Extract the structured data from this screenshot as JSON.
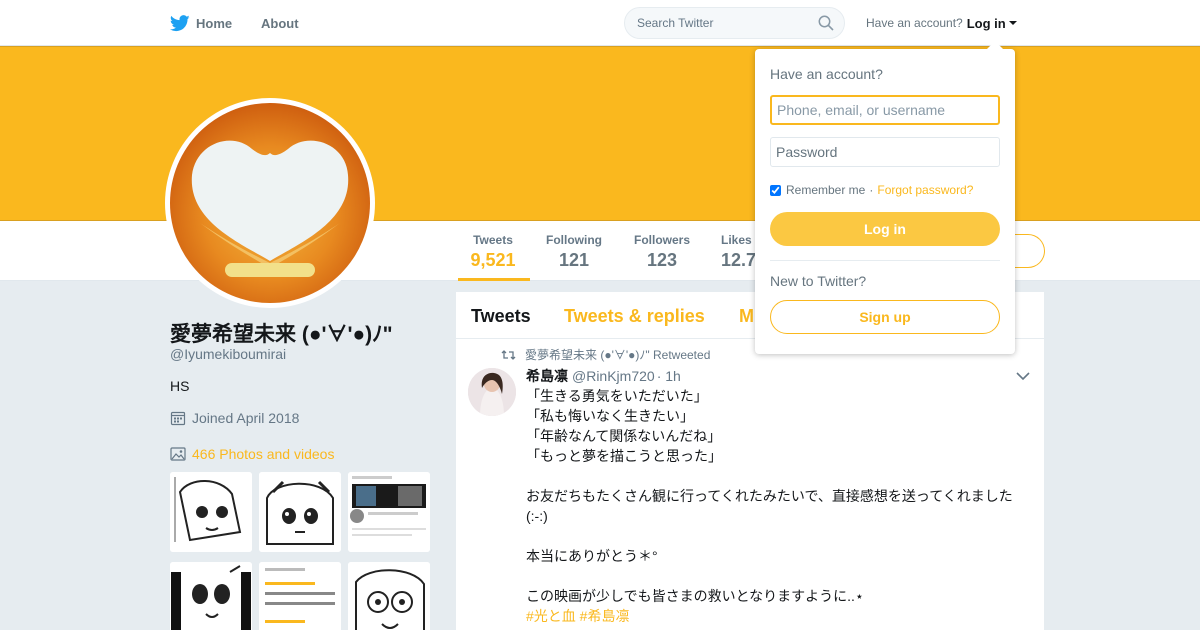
{
  "nav": {
    "home_label": "Home",
    "about_label": "About",
    "search_placeholder": "Search Twitter",
    "have_account": "Have an account?",
    "login_label": "Log in"
  },
  "colors": {
    "accent": "#fab81e",
    "banner": "#fab81e",
    "twitter_blue": "#1da1f2"
  },
  "profile": {
    "name": "愛夢希望未来 (●'∀'●)ﾉ\"",
    "handle": "@Iyumekiboumirai",
    "bio": "HS",
    "joined": "Joined April 2018",
    "photos_link": "466 Photos and videos"
  },
  "stats": [
    {
      "label": "Tweets",
      "value": "9,521"
    },
    {
      "label": "Following",
      "value": "121"
    },
    {
      "label": "Followers",
      "value": "123"
    },
    {
      "label": "Likes",
      "value": "12.7"
    }
  ],
  "timeline": {
    "tabs": [
      "Tweets",
      "Tweets & replies",
      "M"
    ],
    "retweet_context": "愛夢希望未来 (●'∀'●)ﾉ\" Retweeted",
    "tweet": {
      "name": "希島凛",
      "handle": "@RinKjm720",
      "time": "· 1h",
      "lines": [
        "「生きる勇気をいただいた」",
        "「私も悔いなく生きたい」",
        "「年齢なんて関係ないんだね」",
        "「もっと夢を描こうと思った」",
        "",
        "お友だちもたくさん観に行ってくれたみたいで、直接感想を送ってくれました(:-:)",
        "",
        "本当にありがとう＊°",
        "",
        "この映画が少しでも皆さまの救いとなりますように..⋆",
        "#光と血 #希島凛"
      ]
    }
  },
  "login_dropdown": {
    "title": "Have an account?",
    "username_placeholder": "Phone, email, or username",
    "password_placeholder": "Password",
    "remember_label": "Remember me",
    "forgot_label": "Forgot password?",
    "remember_checked": true,
    "login_button": "Log in",
    "new_label": "New to Twitter?",
    "signup_button": "Sign up"
  }
}
